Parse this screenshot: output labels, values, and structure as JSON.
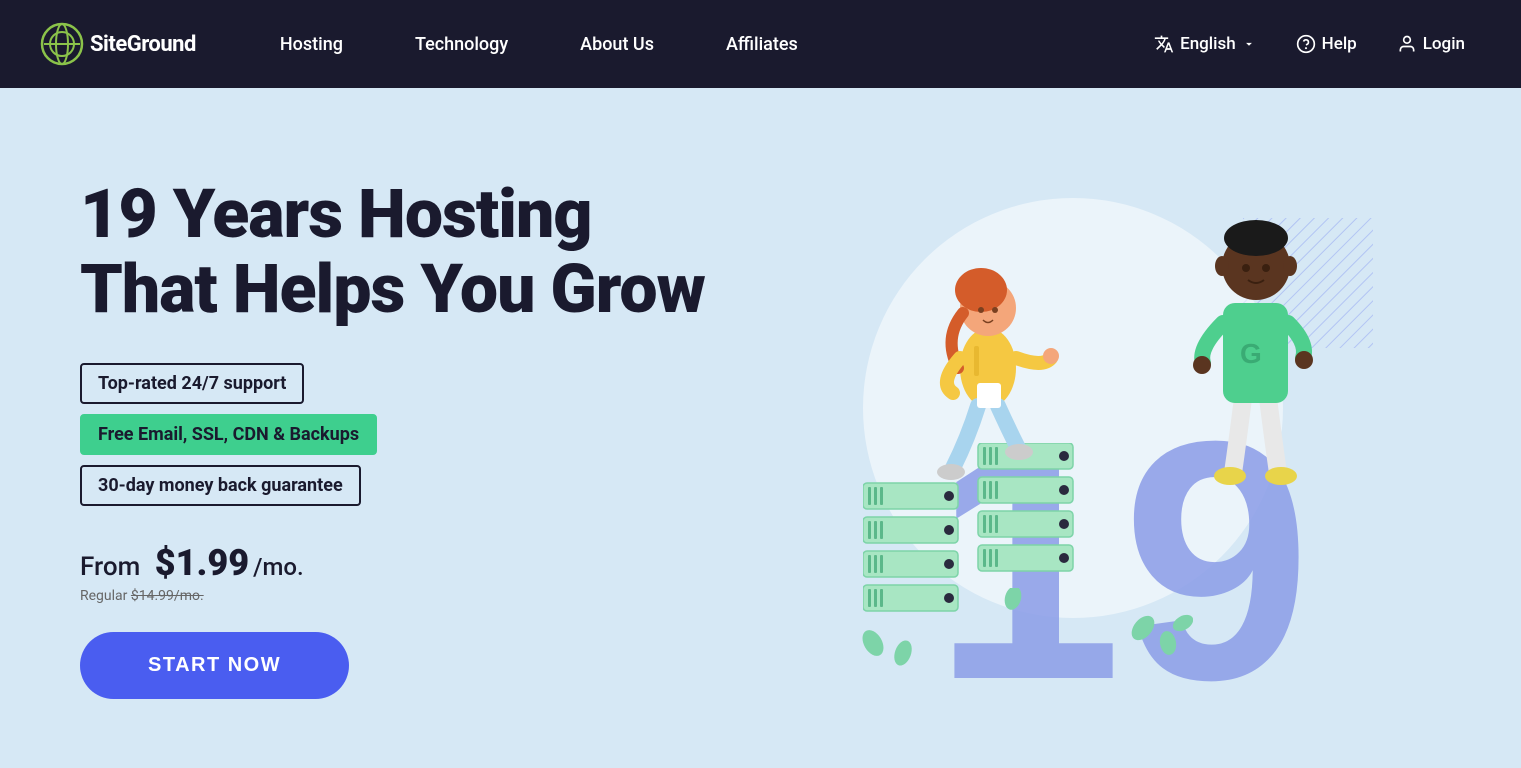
{
  "nav": {
    "logo_text": "SiteGround",
    "links": [
      {
        "label": "Hosting",
        "id": "hosting"
      },
      {
        "label": "Technology",
        "id": "technology"
      },
      {
        "label": "About Us",
        "id": "about-us"
      },
      {
        "label": "Affiliates",
        "id": "affiliates"
      }
    ],
    "right": [
      {
        "label": "English",
        "id": "language",
        "icon": "translate-icon",
        "has_dropdown": true
      },
      {
        "label": "Help",
        "id": "help",
        "icon": "help-icon"
      },
      {
        "label": "Login",
        "id": "login",
        "icon": "user-icon"
      }
    ]
  },
  "hero": {
    "title_line1": "19 Years Hosting",
    "title_line2": "That Helps You Grow",
    "badges": [
      {
        "text": "Top-rated 24/7 support",
        "style": "outline"
      },
      {
        "text": "Free Email, SSL, CDN & Backups",
        "style": "green"
      },
      {
        "text": "30-day money back guarantee",
        "style": "outline"
      }
    ],
    "price_from": "From",
    "price_amount": "$1.99",
    "price_period": "/mo.",
    "price_regular_label": "Regular",
    "price_regular_amount": "$14.99/mo.",
    "cta_button": "START NOW"
  },
  "colors": {
    "background": "#d6e8f5",
    "nav_bg": "#1a1a2e",
    "accent_blue": "#4a5df0",
    "accent_green": "#3ecf8e",
    "number_color": "#7b8fe8",
    "server_color": "#a8e6c3"
  }
}
